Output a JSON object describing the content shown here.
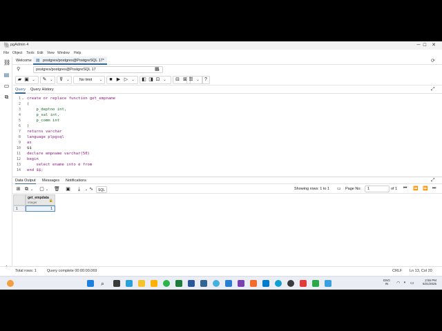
{
  "window": {
    "title": "pgAdmin 4",
    "minimize": "─",
    "maximize": "☐",
    "close": "✕"
  },
  "menu": [
    "File",
    "Object",
    "Tools",
    "Edit",
    "View",
    "Window",
    "Help"
  ],
  "tabs": {
    "welcome": "Welcome",
    "query": "postgres/postgres@PostgreSQL 17*"
  },
  "connection": {
    "selected": "postgres/postgres@PostgreSQL 17"
  },
  "toolbar": {
    "limit": "No limit"
  },
  "query_tabs": {
    "query": "Query",
    "history": "Query History"
  },
  "editor": {
    "lines": [
      {
        "n": "1",
        "text": "create or replace function get_empname"
      },
      {
        "n": "2",
        "text": "("
      },
      {
        "n": "3",
        "text": "    p_deptno int,"
      },
      {
        "n": "4",
        "text": "    p_sal int,"
      },
      {
        "n": "5",
        "text": "    p_comm int"
      },
      {
        "n": "6",
        "text": ")"
      },
      {
        "n": "7",
        "text": "returns varchar"
      },
      {
        "n": "8",
        "text": "language plpgsql"
      },
      {
        "n": "9",
        "text": "as"
      },
      {
        "n": "10",
        "text": "$$"
      },
      {
        "n": "11",
        "text": "declare empname varchar(50)"
      },
      {
        "n": "12",
        "text": "begin"
      },
      {
        "n": "13",
        "text": "    select ename into e from"
      },
      {
        "n": "14",
        "text": "end $$;"
      }
    ]
  },
  "result_tabs": {
    "data_output": "Data Output",
    "messages": "Messages",
    "notifications": "Notifications"
  },
  "result_toolbar": {
    "sql": "SQL",
    "showing": "Showing rows: 1 to 1",
    "page_no_label": "Page No:",
    "page_no": "1",
    "page_of": "of 1"
  },
  "grid": {
    "column_name": "get_empdata",
    "column_type": "integer",
    "row_number": "1",
    "value": "1"
  },
  "status": {
    "total_rows": "Total rows: 1",
    "query_complete": "Query complete 00:00:00.069",
    "eol": "CRLF",
    "cursor": "Ln 13, Col 20"
  },
  "taskbar": {
    "lang": "ENG",
    "region": "IN",
    "time": "2:55 PM",
    "date": "6/21/2025"
  }
}
